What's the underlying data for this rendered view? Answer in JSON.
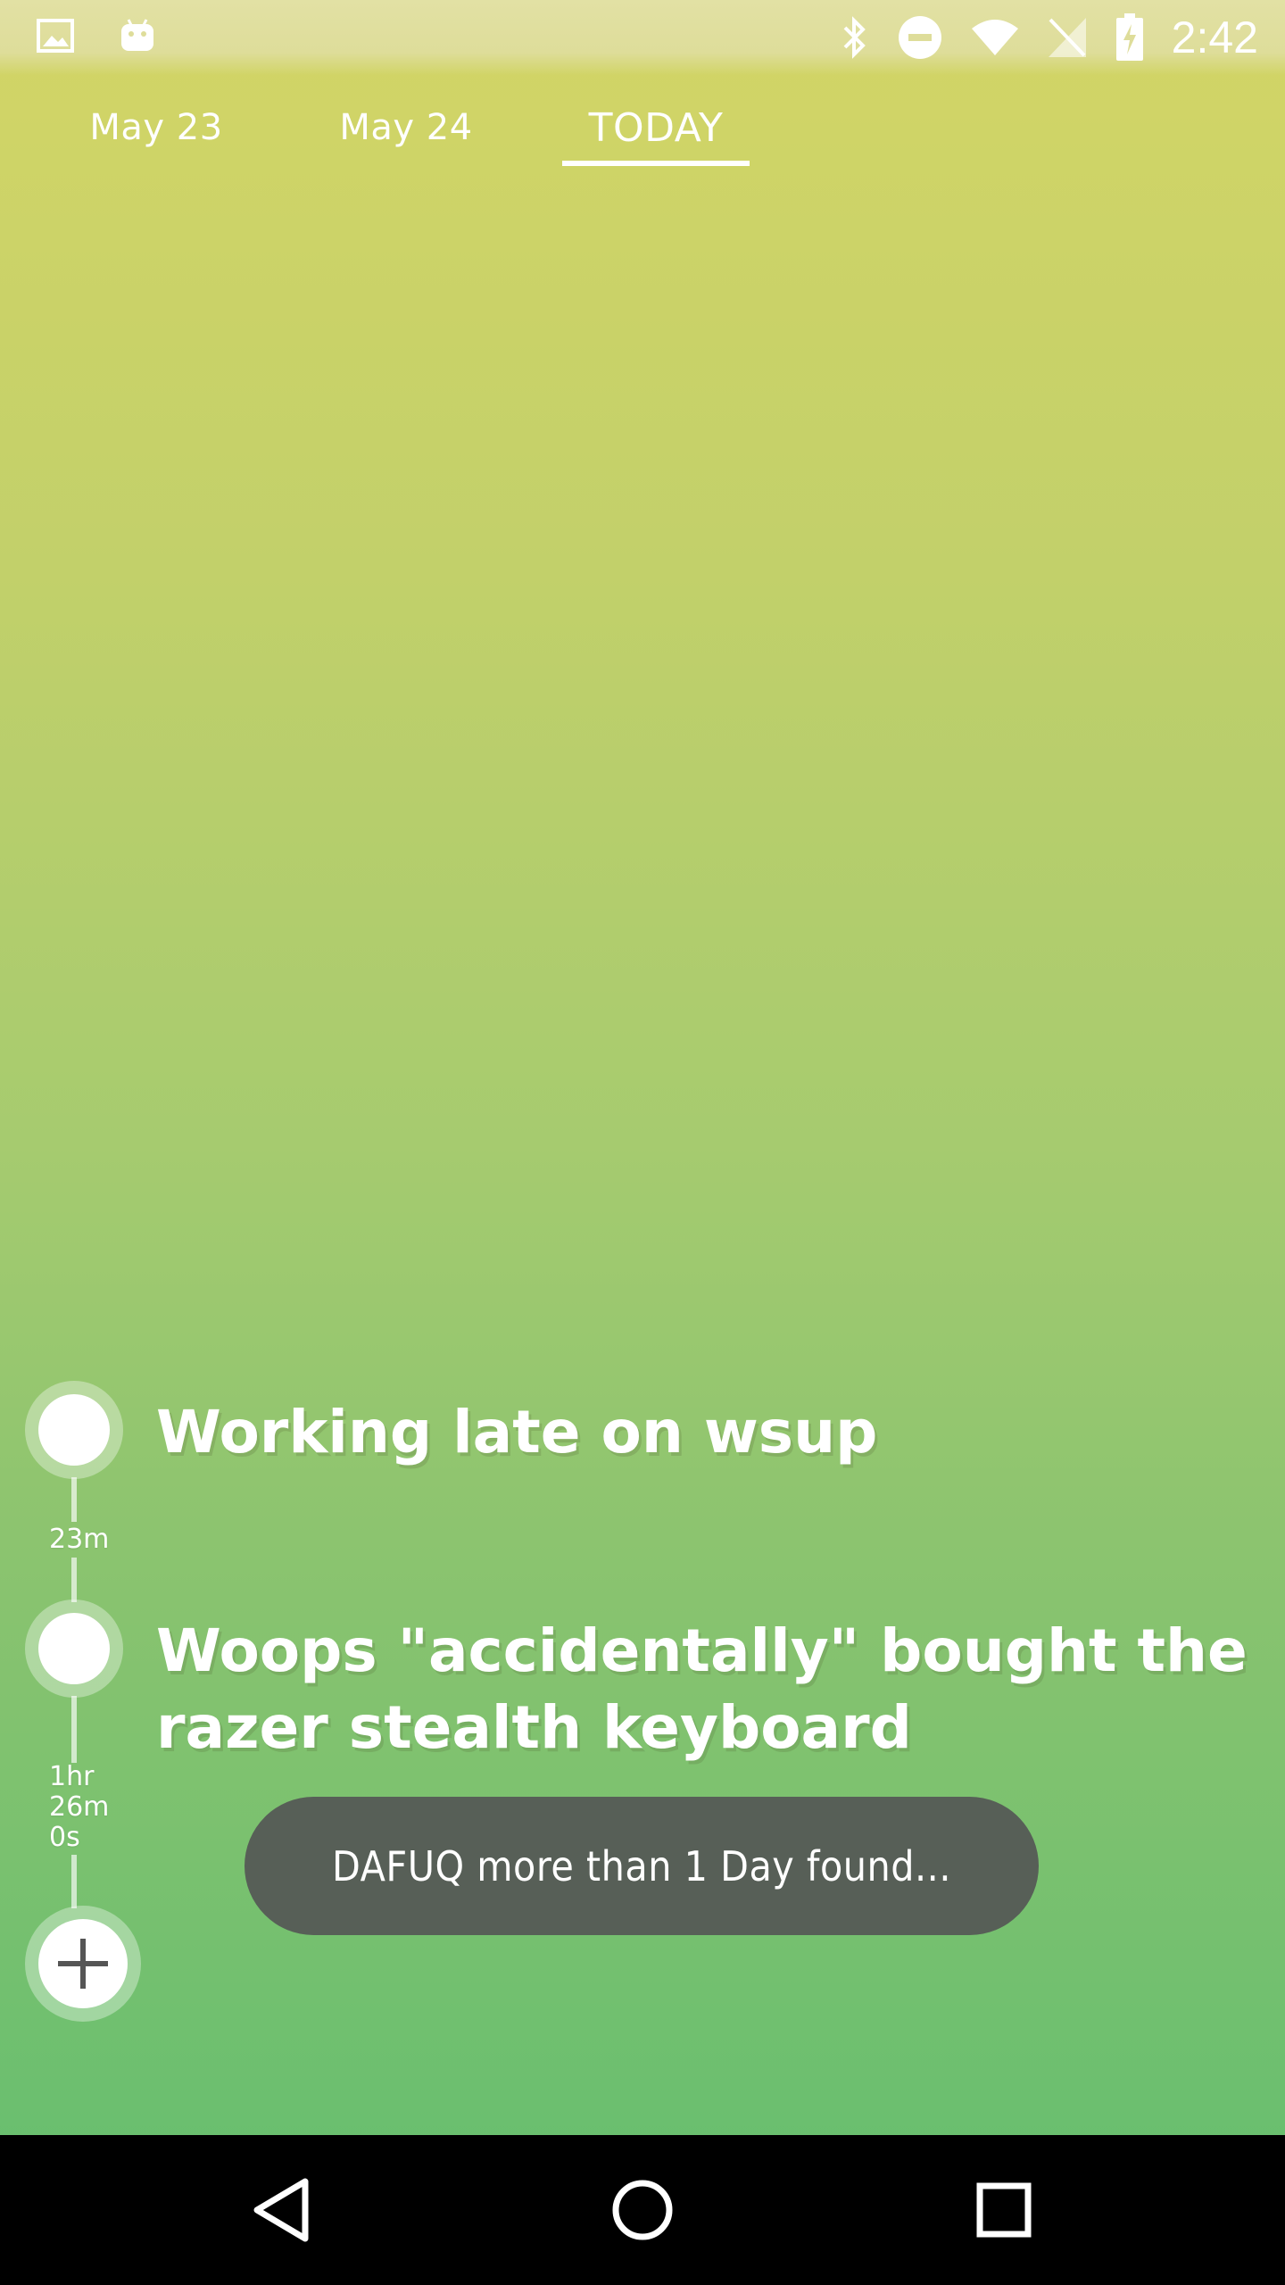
{
  "status_bar": {
    "time": "2:42",
    "left_icons": [
      "image-icon",
      "android-icon"
    ],
    "right_icons": [
      "bluetooth-icon",
      "do-not-disturb-icon",
      "wifi-icon",
      "no-sim-icon",
      "battery-charging-icon"
    ]
  },
  "tabs": [
    {
      "label": "May 23",
      "active": false
    },
    {
      "label": "May 24",
      "active": false
    },
    {
      "label": "TODAY",
      "active": true
    }
  ],
  "timeline": {
    "entries": [
      {
        "text_line1": "Working late on wsup",
        "text_line2": ""
      },
      {
        "text_line1": "Woops \"accidentally\" bought the",
        "text_line2": "razer stealth keyboard"
      }
    ],
    "durations": [
      {
        "lines": [
          "23m"
        ]
      },
      {
        "lines": [
          "1hr",
          "26m",
          "0s"
        ]
      }
    ],
    "add_icon": "plus-icon"
  },
  "toast": {
    "message": "DAFUQ more than 1 Day found..."
  },
  "nav_bar": {
    "icons": [
      "back-icon",
      "home-icon",
      "recents-icon"
    ]
  },
  "colors": {
    "gradient_top": "#d3d566",
    "gradient_bottom": "#62bd6d",
    "toast_bg": "#575f57",
    "nav_bg": "#000000"
  }
}
